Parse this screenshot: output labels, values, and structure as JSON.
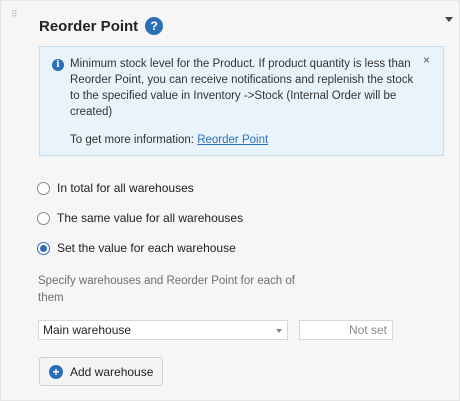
{
  "header": {
    "title": "Reorder Point",
    "help_icon": "?"
  },
  "info": {
    "text": "Minimum stock level for the Product. If product quantity is less than Reorder Point, you can receive notifications and replenish the stock to the specified value in Inventory ->Stock (Internal Order will be created)",
    "more_prefix": "To get more information: ",
    "more_link": "Reorder Point",
    "close": "×"
  },
  "options": [
    {
      "label": "In total for all warehouses",
      "checked": false
    },
    {
      "label": "The same value for all warehouses",
      "checked": false
    },
    {
      "label": "Set the value for each warehouse",
      "checked": true
    }
  ],
  "hint": "Specify warehouses and Reorder Point for each of them",
  "warehouse": {
    "selected": "Main warehouse",
    "value_placeholder": "Not set"
  },
  "add_button": {
    "label": "Add warehouse"
  },
  "colors": {
    "accent": "#2b6fb6",
    "info_bg": "#e8f3fb",
    "panel_bg": "#f6f6f6"
  },
  "icons": {
    "help": "question-circle-icon",
    "info": "info-circle-icon",
    "close": "close-icon",
    "collapse": "caret-down-icon",
    "add": "plus-circle-icon"
  }
}
